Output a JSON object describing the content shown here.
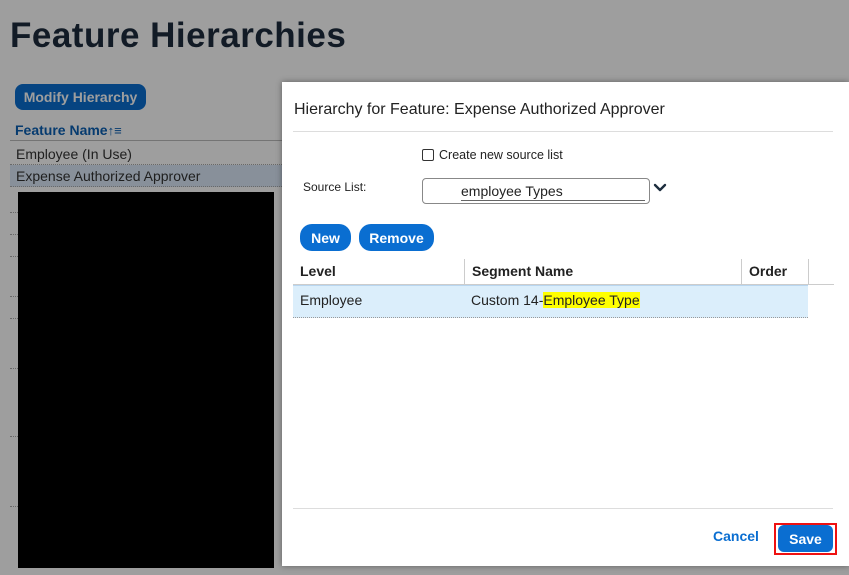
{
  "page": {
    "title": "Feature Hierarchies",
    "modify_button": "Modify Hierarchy",
    "list_header": "Feature Name",
    "sort_icon": "sort-ascending-icon",
    "list_rows": [
      "Employee (In Use)",
      "Expense Authorized Approver"
    ]
  },
  "dialog": {
    "title": "Hierarchy for Feature: Expense Authorized Approver",
    "create_new_label": "Create new source list",
    "create_new_checked": false,
    "source_list_label": "Source List:",
    "source_list_value": "employee Types",
    "dropdown_icon": "chevron-down-icon",
    "new_button": "New",
    "remove_button": "Remove",
    "table": {
      "headers": [
        "Level",
        "Segment Name",
        "Order"
      ],
      "rows": [
        {
          "level": "Employee",
          "segment_prefix": "Custom 14-",
          "segment_highlight": "Employee Type",
          "order": ""
        }
      ]
    },
    "cancel_button": "Cancel",
    "save_button": "Save"
  },
  "colors": {
    "accent": "#0a6ed1",
    "highlight": "#ffff00",
    "selected_row": "#dbeefb",
    "save_outline": "#ee1111"
  }
}
